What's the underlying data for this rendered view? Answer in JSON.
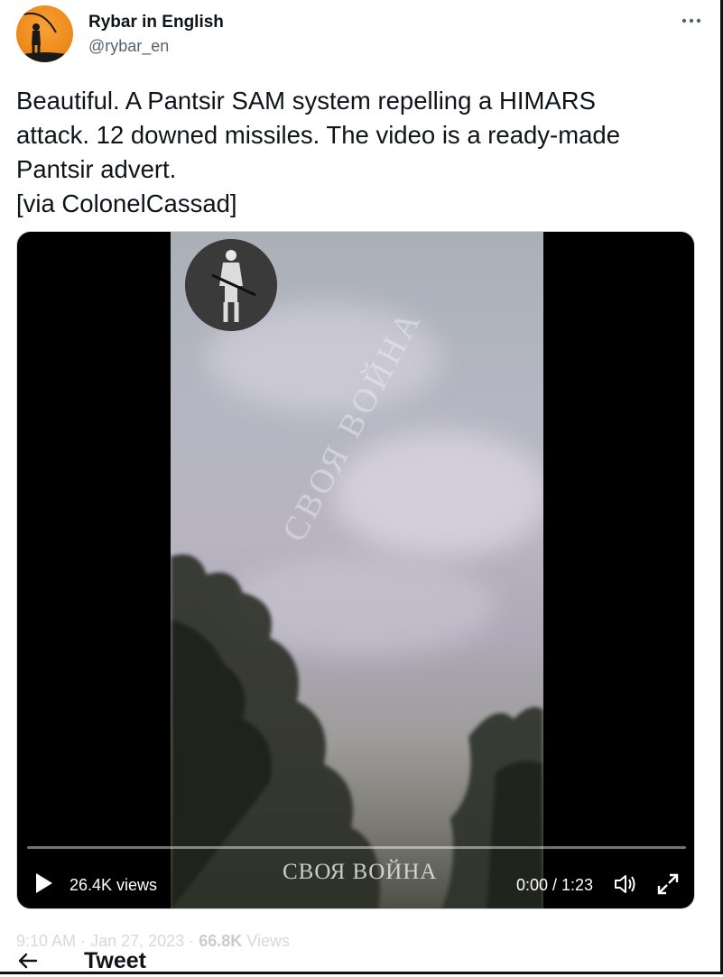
{
  "author": {
    "name": "Rybar in English",
    "handle": "@rybar_en"
  },
  "tweet": {
    "text": "Beautiful. A Pantsir SAM system repelling a HIMARS\nattack. 12 downed missiles. The video is a ready-made\nPantsir advert.\n[via ColonelCassad]"
  },
  "video": {
    "views": "26.4K views",
    "time": "0:00 / 1:23",
    "progress": 0.0,
    "watermark_diagonal": "СВОЯ ВОЙНА",
    "watermark_bottom": "СВОЯ ВОЙНА"
  },
  "meta": {
    "time": "9:10 AM",
    "date": "Jan 27, 2023",
    "separator": "·",
    "views_count": "66.8K",
    "views_label": "Views"
  },
  "nav": {
    "title": "Tweet"
  },
  "icons": [
    "more-icon",
    "play-icon",
    "volume-icon",
    "fullscreen-icon",
    "back-arrow-icon"
  ],
  "colors": {
    "accent": "#1d9bf0",
    "avatar": "#ef8a1c",
    "text": "#0f1419",
    "muted": "#536471"
  }
}
